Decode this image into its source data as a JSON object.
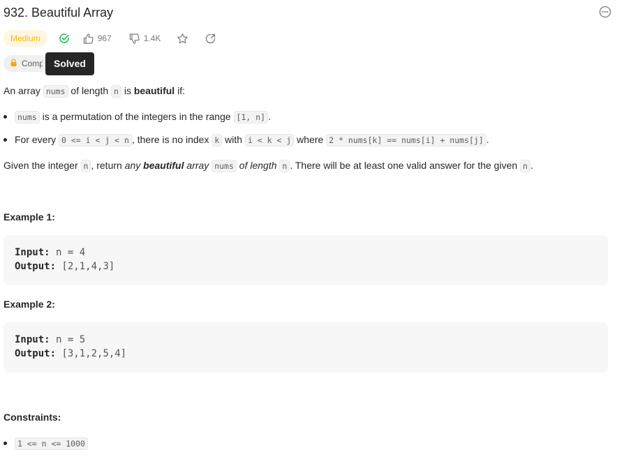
{
  "problem": {
    "title": "932. Beautiful Array",
    "difficulty": "Medium",
    "likes": "967",
    "dislikes": "1.4K",
    "companies_label": "Comp",
    "tooltip": "Solved"
  },
  "description": {
    "intro": [
      "An array ",
      "nums",
      " of length ",
      "n",
      " is ",
      "beautiful",
      " if:"
    ],
    "bullet1": [
      "nums",
      " is a permutation of the integers in the range ",
      "[1, n]",
      "."
    ],
    "bullet2": [
      "For every ",
      "0 <= i < j < n",
      ", there is no index ",
      "k",
      " with ",
      "i < k < j",
      " where ",
      "2 * nums[k] == nums[i] + nums[j]",
      "."
    ],
    "given": [
      "Given the integer ",
      "n",
      ", return ",
      "any",
      " ",
      "beautiful",
      " ",
      "array",
      " ",
      "nums",
      " ",
      "of length",
      " ",
      "n",
      ". There will be at least one valid answer for the given ",
      "n",
      "."
    ]
  },
  "examples": [
    {
      "heading": "Example 1:",
      "input_label": "Input:",
      "input": "n = 4",
      "output_label": "Output:",
      "output": "[2,1,4,3]"
    },
    {
      "heading": "Example 2:",
      "input_label": "Input:",
      "input": "n = 5",
      "output_label": "Output:",
      "output": "[3,1,2,5,4]"
    }
  ],
  "constraints": {
    "heading": "Constraints:",
    "items": [
      "1 <= n <= 1000"
    ]
  },
  "colors": {
    "medium": "#ffb800",
    "solved_check": "#2cbb5d",
    "tooltip_bg": "#262626"
  },
  "icons": [
    "solved-check-icon",
    "thumbs-up-icon",
    "thumbs-down-icon",
    "star-icon",
    "share-icon",
    "lock-icon",
    "more-options-icon"
  ]
}
